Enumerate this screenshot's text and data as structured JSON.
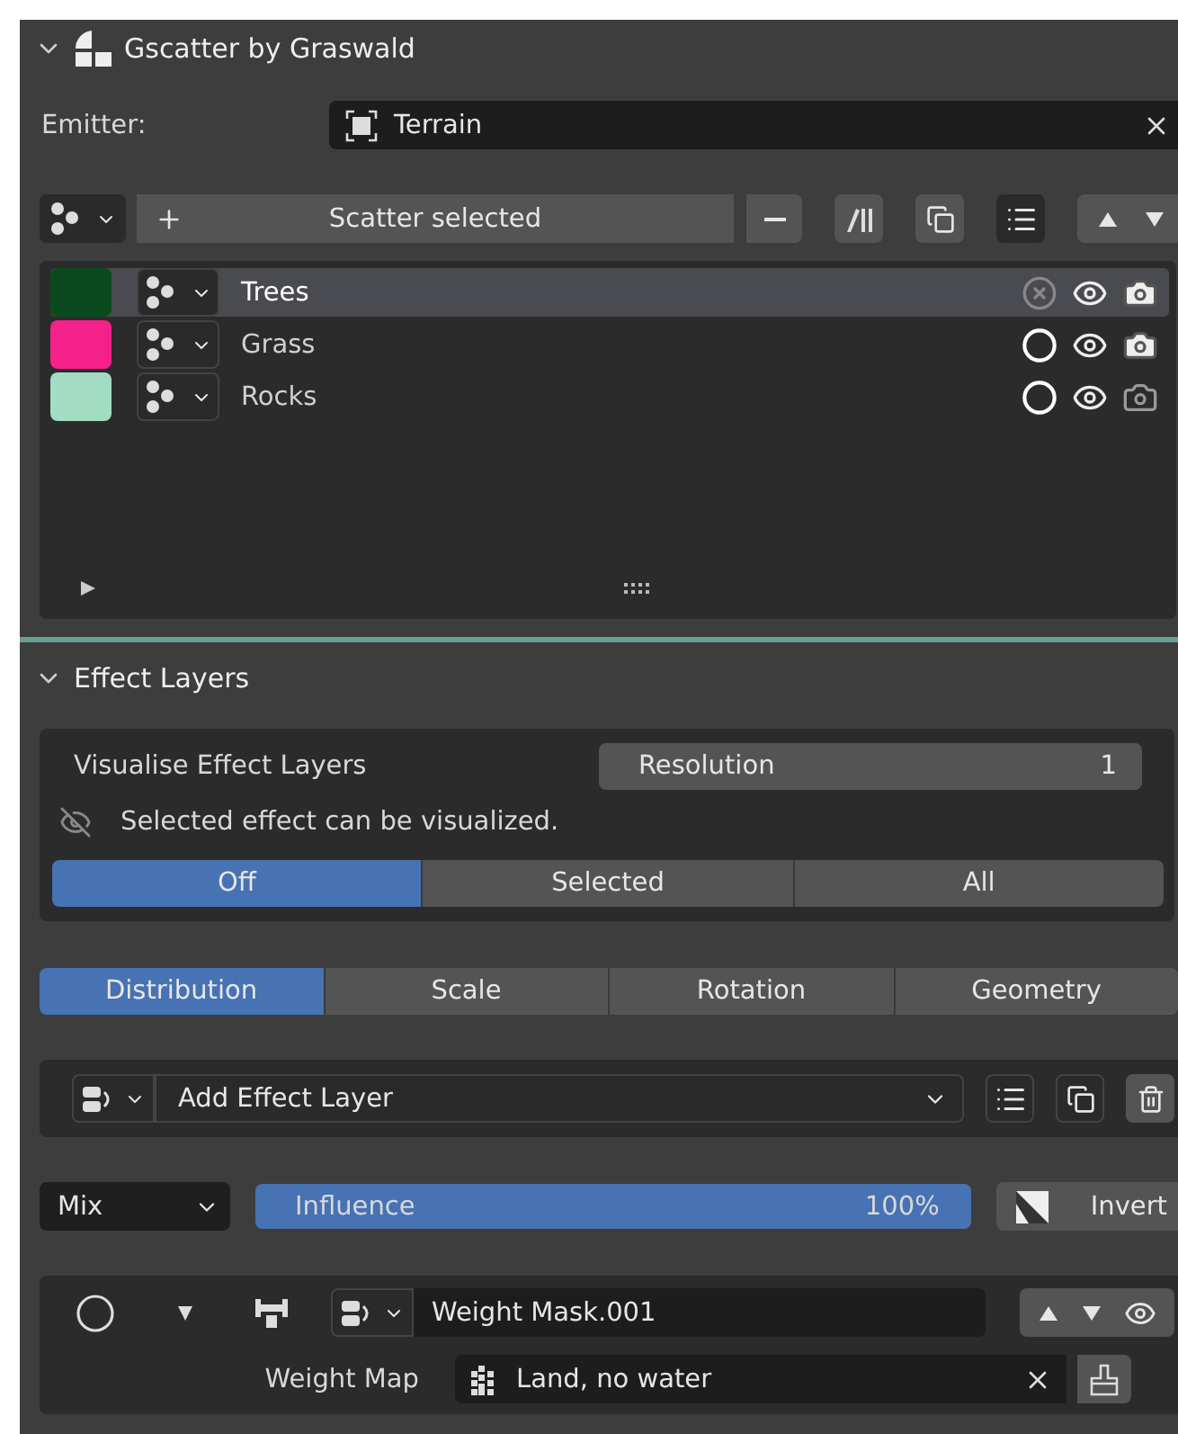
{
  "panel": {
    "title": "Gscatter by Graswald",
    "expanded": true
  },
  "emitter": {
    "label": "Emitter:",
    "value": "Terrain"
  },
  "scatter_toolbar": {
    "button": "Scatter selected"
  },
  "scatter_list": [
    {
      "name": "Trees",
      "color": "#0b4a1f",
      "selected": true,
      "selectable": false,
      "visible": true,
      "render": true
    },
    {
      "name": "Grass",
      "color": "#f5218a",
      "selected": false,
      "selectable": true,
      "visible": true,
      "render": true
    },
    {
      "name": "Rocks",
      "color": "#a2dcc2",
      "selected": false,
      "selectable": true,
      "visible": true,
      "render": false
    }
  ],
  "effect_layers": {
    "title": "Effect Layers",
    "expanded": true,
    "visualise_label": "Visualise Effect Layers",
    "resolution": {
      "label": "Resolution",
      "value": "1"
    },
    "hint": "Selected effect can be visualized.",
    "modes": [
      {
        "label": "Off",
        "selected": true
      },
      {
        "label": "Selected",
        "selected": false
      },
      {
        "label": "All",
        "selected": false
      }
    ]
  },
  "tabs": [
    {
      "label": "Distribution",
      "selected": true
    },
    {
      "label": "Scale",
      "selected": false
    },
    {
      "label": "Rotation",
      "selected": false
    },
    {
      "label": "Geometry",
      "selected": false
    }
  ],
  "add_layer": {
    "label": "Add Effect Layer"
  },
  "blend": {
    "value": "Mix"
  },
  "influence": {
    "label": "Influence",
    "reading": "100%",
    "level": 1
  },
  "invert": {
    "label": "Invert"
  },
  "layer": {
    "name": "Weight Mask.001",
    "enabled": false,
    "weight_map_label": "Weight Map",
    "weight_map_value": "Land, no water"
  }
}
